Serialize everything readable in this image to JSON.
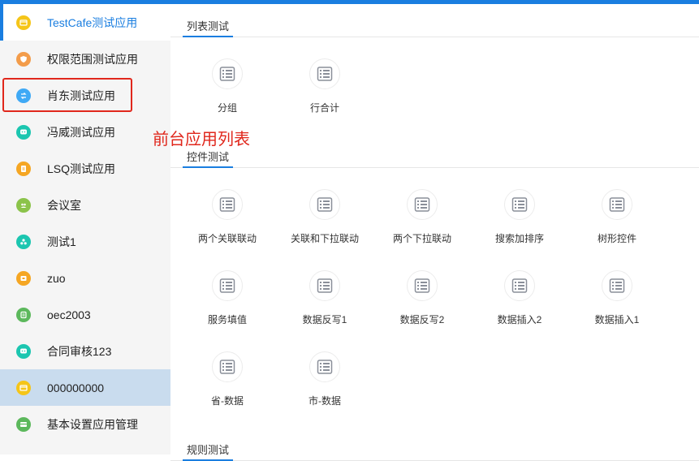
{
  "sidebar": {
    "items": [
      {
        "label": "TestCafe测试应用",
        "icon": "window-icon",
        "color": "#f5c518"
      },
      {
        "label": "权限范围测试应用",
        "icon": "shield-icon",
        "color": "#f39c4a"
      },
      {
        "label": "肖东测试应用",
        "icon": "sync-icon",
        "color": "#3fa9f5"
      },
      {
        "label": "冯威测试应用",
        "icon": "chat-icon",
        "color": "#1cc6b0"
      },
      {
        "label": "LSQ测试应用",
        "icon": "doc-icon",
        "color": "#f5a623"
      },
      {
        "label": "会议室",
        "icon": "people-icon",
        "color": "#8bc34a"
      },
      {
        "label": "测试1",
        "icon": "group-icon",
        "color": "#1cc6b0"
      },
      {
        "label": "zuo",
        "icon": "folder-icon",
        "color": "#f5a623"
      },
      {
        "label": "oec2003",
        "icon": "list-icon",
        "color": "#5cb85c"
      },
      {
        "label": "合同审核123",
        "icon": "chat-icon",
        "color": "#1cc6b0"
      },
      {
        "label": "000000000",
        "icon": "window-icon",
        "color": "#f5c518"
      },
      {
        "label": "基本设置应用管理",
        "icon": "card-icon",
        "color": "#5cb85c"
      }
    ]
  },
  "annotation": "前台应用列表",
  "sections": [
    {
      "title": "列表测试",
      "tiles": [
        "分组",
        "行合计"
      ]
    },
    {
      "title": "控件测试",
      "tiles": [
        "两个关联联动",
        "关联和下拉联动",
        "两个下拉联动",
        "搜索加排序",
        "树形控件",
        "服务填值",
        "数据反写1",
        "数据反写2",
        "数据插入2",
        "数据插入1",
        "省-数据",
        "市-数据"
      ]
    },
    {
      "title": "规则测试",
      "tiles": []
    }
  ],
  "colors": {
    "accent": "#1a7ee0",
    "highlight": "#e0271c",
    "selected_bg": "#c9dcee"
  }
}
